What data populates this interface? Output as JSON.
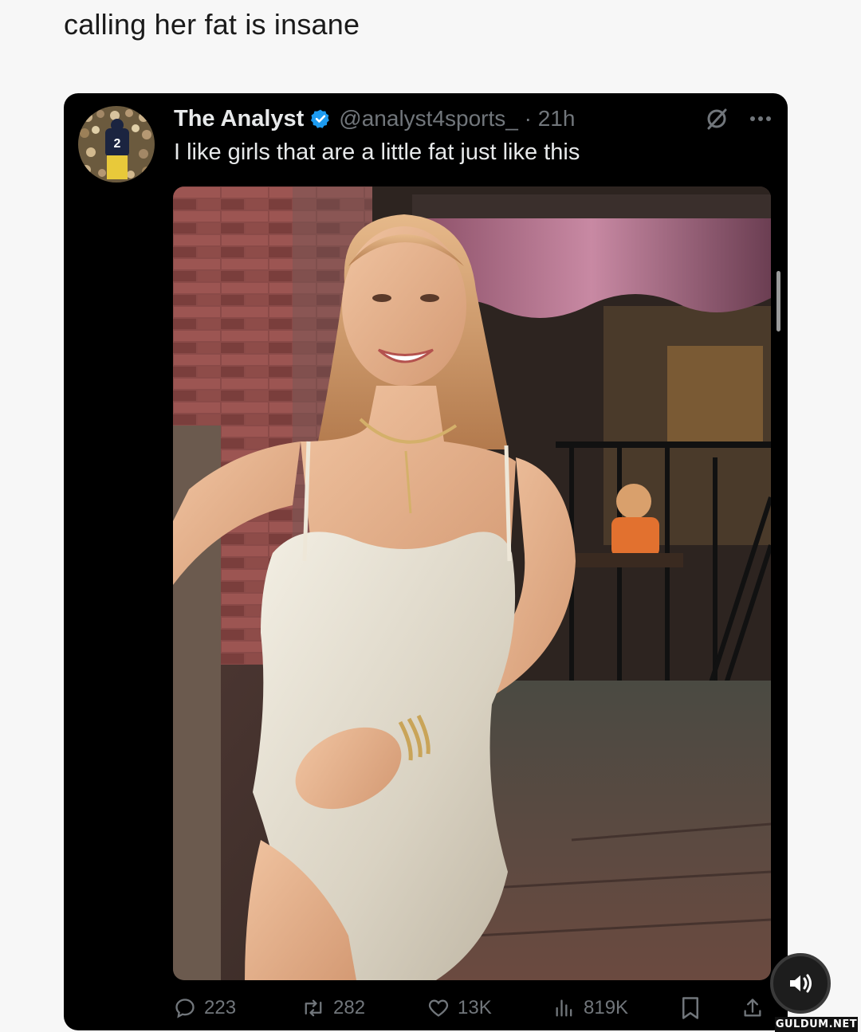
{
  "caption": "calling her fat is insane",
  "tweet": {
    "author_name": "The Analyst",
    "handle_time": "@analyst4sports_ · 21h",
    "text": "I like girls that are a little fat just like this",
    "avatar_jersey_number": "2"
  },
  "actions": {
    "replies": "223",
    "reposts": "282",
    "likes": "13K",
    "views": "819K"
  },
  "watermark": "GULDUM.NET",
  "colors": {
    "card_bg": "#000000",
    "primary_text": "#e7e9ea",
    "secondary_text": "#71767b",
    "verified_blue": "#1d9bf0",
    "page_bg": "#f7f7f7"
  },
  "icons": [
    "verified-badge-icon",
    "grok-icon",
    "more-icon",
    "reply-icon",
    "repost-icon",
    "like-icon",
    "views-icon",
    "bookmark-icon",
    "share-icon",
    "sound-icon"
  ]
}
